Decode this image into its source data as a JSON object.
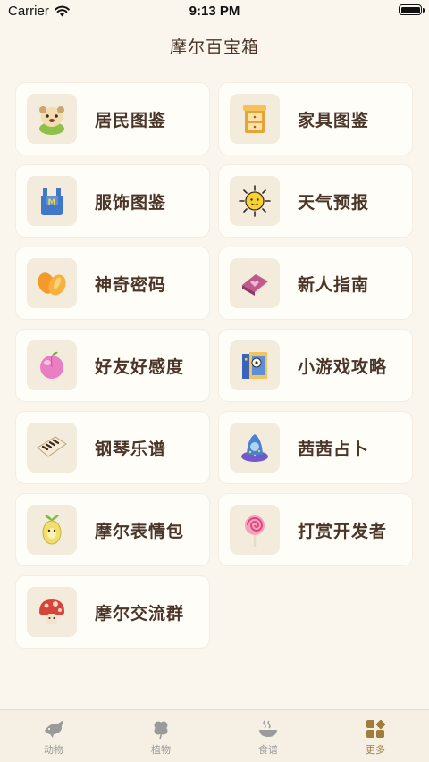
{
  "status_bar": {
    "carrier": "Carrier",
    "time": "9:13 PM"
  },
  "header": {
    "title": "摩尔百宝箱"
  },
  "menu": [
    {
      "label": "居民图鉴",
      "icon": "resident-avatar-icon"
    },
    {
      "label": "家具图鉴",
      "icon": "furniture-cabinet-icon"
    },
    {
      "label": "服饰图鉴",
      "icon": "clothing-overalls-icon"
    },
    {
      "label": "天气预报",
      "icon": "sun-icon"
    },
    {
      "label": "神奇密码",
      "icon": "orange-slices-icon"
    },
    {
      "label": "新人指南",
      "icon": "guide-book-icon"
    },
    {
      "label": "好友好感度",
      "icon": "peach-icon"
    },
    {
      "label": "小游戏攻略",
      "icon": "soccer-door-icon"
    },
    {
      "label": "钢琴乐谱",
      "icon": "piano-keys-icon"
    },
    {
      "label": "茜茜占卜",
      "icon": "fortune-teller-icon"
    },
    {
      "label": "摩尔表情包",
      "icon": "egg-sticker-icon"
    },
    {
      "label": "打赏开发者",
      "icon": "lollipop-icon"
    },
    {
      "label": "摩尔交流群",
      "icon": "mushroom-icon"
    }
  ],
  "tab_bar": {
    "tabs": [
      {
        "label": "动物",
        "icon": "fish-icon"
      },
      {
        "label": "植物",
        "icon": "clover-icon"
      },
      {
        "label": "食谱",
        "icon": "bowl-icon"
      },
      {
        "label": "更多",
        "icon": "more-grid-icon"
      }
    ],
    "active_index": 3,
    "active_color": "#a07c3d",
    "inactive_color": "#9a9a9a"
  }
}
